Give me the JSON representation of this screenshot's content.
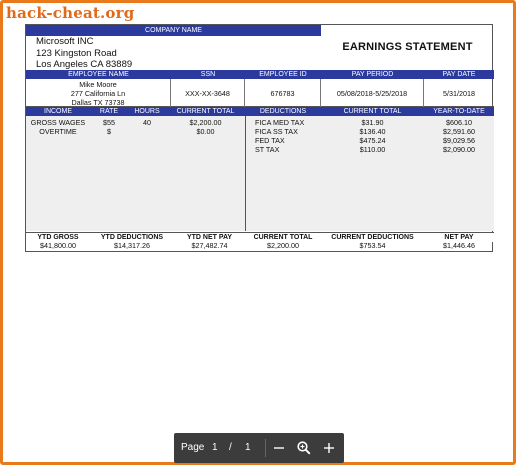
{
  "watermark": "hack-cheat.org",
  "company": {
    "header": "COMPANY NAME",
    "name": "Microsoft INC",
    "address1": "123 Kingston Road",
    "address2": "Los Angeles CA 83889"
  },
  "title": "EARNINGS STATEMENT",
  "employee_headers": [
    "EMPLOYEE NAME",
    "SSN",
    "EMPLOYEE ID",
    "PAY PERIOD",
    "PAY DATE"
  ],
  "employee": {
    "name": "Mike Moore",
    "street": "277 California Ln",
    "city": "Dallas TX 73738",
    "ssn": "XXX-XX-3648",
    "id": "676783",
    "pay_period": "05/08/2018-5/25/2018",
    "pay_date": "5/31/2018"
  },
  "earnings_headers": [
    "INCOME",
    "RATE",
    "HOURS",
    "CURRENT TOTAL",
    "DEDUCTIONS",
    "CURRENT TOTAL",
    "YEAR-TO-DATE"
  ],
  "income_rows": [
    {
      "income": "GROSS WAGES",
      "rate": "$55",
      "hours": "40",
      "total": "$2,200.00"
    },
    {
      "income": "OVERTIME",
      "rate": "$",
      "hours": "",
      "total": "$0.00"
    }
  ],
  "deduction_rows": [
    {
      "name": "FICA MED TAX",
      "current": "$31.90",
      "ytd": "$606.10"
    },
    {
      "name": "FICA SS TAX",
      "current": "$136.40",
      "ytd": "$2,591.60"
    },
    {
      "name": "FED TAX",
      "current": "$475.24",
      "ytd": "$9,029.56"
    },
    {
      "name": "ST TAX",
      "current": "$110.00",
      "ytd": "$2,090.00"
    }
  ],
  "totals": {
    "labels": [
      "YTD GROSS",
      "YTD DEDUCTIONS",
      "YTD NET PAY",
      "CURRENT TOTAL",
      "CURRENT DEDUCTIONS",
      "NET PAY"
    ],
    "values": [
      "$41,800.00",
      "$14,317.26",
      "$27,482.74",
      "$2,200.00",
      "$753.54",
      "$1,446.46"
    ]
  },
  "viewer": {
    "page_label": "Page",
    "current_page": "1",
    "separator": "/",
    "total_pages": "1",
    "icons": [
      "zoom-out-icon",
      "zoom-search-icon",
      "zoom-in-icon"
    ]
  }
}
